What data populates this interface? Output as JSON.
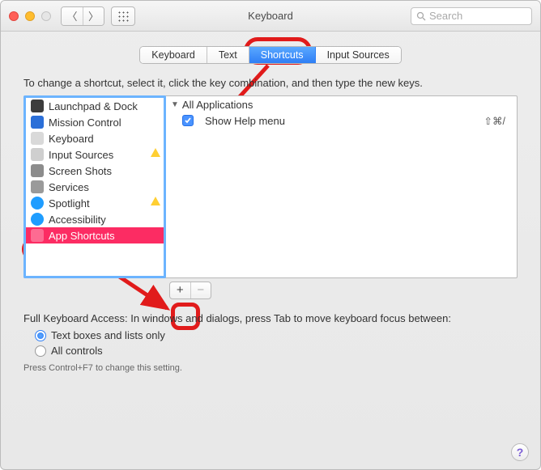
{
  "title": "Keyboard",
  "search_placeholder": "Search",
  "tabs": [
    {
      "label": "Keyboard",
      "active": false
    },
    {
      "label": "Text",
      "active": false
    },
    {
      "label": "Shortcuts",
      "active": true
    },
    {
      "label": "Input Sources",
      "active": false
    }
  ],
  "instruction": "To change a shortcut, select it, click the key combination, and then type the new keys.",
  "categories": [
    {
      "label": "Launchpad & Dock",
      "icon": "launchpad",
      "warn": false,
      "selected": false
    },
    {
      "label": "Mission Control",
      "icon": "mission-control",
      "warn": false,
      "selected": false
    },
    {
      "label": "Keyboard",
      "icon": "keyboard",
      "warn": false,
      "selected": false
    },
    {
      "label": "Input Sources",
      "icon": "input-sources",
      "warn": true,
      "selected": false
    },
    {
      "label": "Screen Shots",
      "icon": "screen-shots",
      "warn": false,
      "selected": false
    },
    {
      "label": "Services",
      "icon": "services",
      "warn": false,
      "selected": false
    },
    {
      "label": "Spotlight",
      "icon": "spotlight",
      "warn": true,
      "selected": false
    },
    {
      "label": "Accessibility",
      "icon": "accessibility",
      "warn": false,
      "selected": false
    },
    {
      "label": "App Shortcuts",
      "icon": "app-shortcuts",
      "warn": false,
      "selected": true
    }
  ],
  "group_label": "All Applications",
  "shortcuts": [
    {
      "enabled": true,
      "name": "Show Help menu",
      "keys": "⇧⌘/"
    }
  ],
  "plus_label": "+",
  "minus_label": "−",
  "full_keyboard_access_label": "Full Keyboard Access: In windows and dialogs, press Tab to move keyboard focus between:",
  "radios": [
    {
      "label": "Text boxes and lists only",
      "checked": true
    },
    {
      "label": "All controls",
      "checked": false
    }
  ],
  "hint": "Press Control+F7 to change this setting.",
  "help_label": "?",
  "icon_colors": {
    "launchpad": "#3c3c3c",
    "mission-control": "#2b6fd8",
    "keyboard": "#d9d9d9",
    "input-sources": "#cfcfcf",
    "screen-shots": "#8c8c8c",
    "services": "#9a9a9a",
    "spotlight": "#1f9dff",
    "accessibility": "#1f9dff",
    "app-shortcuts": "#ff8fb3"
  }
}
